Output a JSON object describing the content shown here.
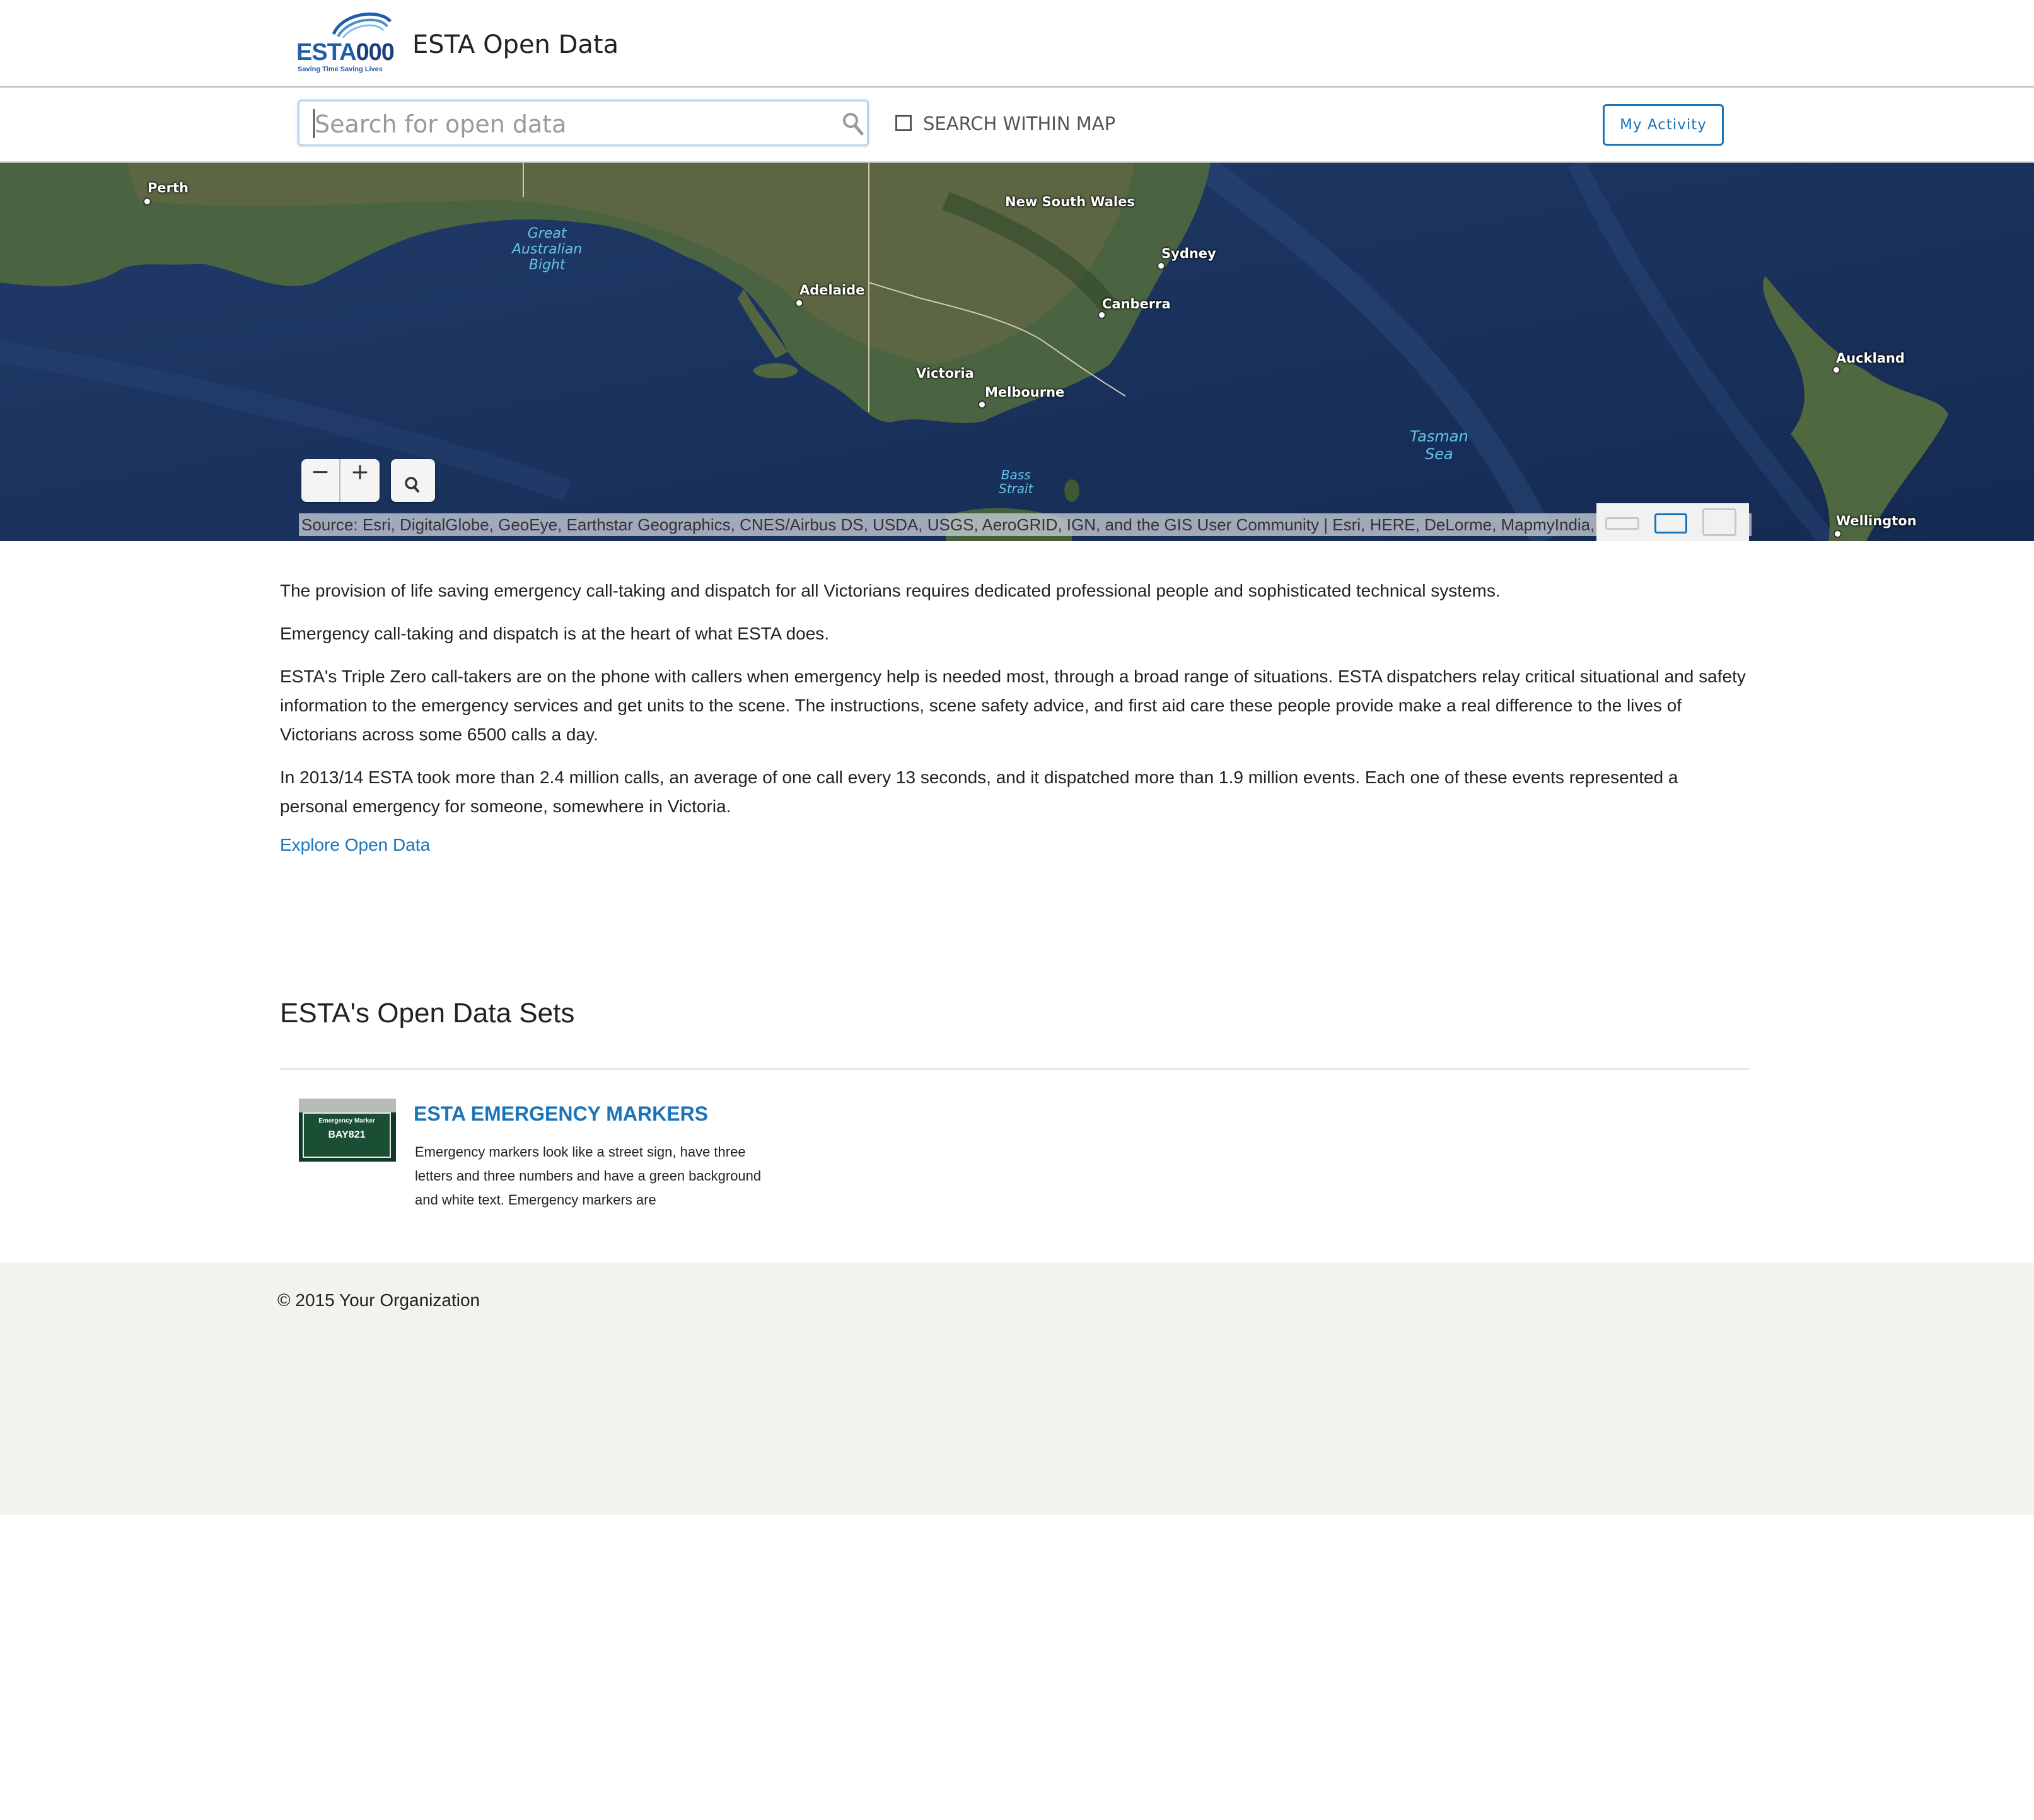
{
  "header": {
    "logo_name": "ESTA",
    "logo_number": "000",
    "logo_tagline": "Saving Time Saving Lives",
    "site_title": "ESTA Open Data"
  },
  "search": {
    "placeholder": "Search for open data",
    "value": "",
    "within_map_label": "SEARCH WITHIN MAP",
    "within_map_checked": false,
    "my_activity_label": "My Activity"
  },
  "map": {
    "city_labels": {
      "perth": "Perth",
      "adelaide": "Adelaide",
      "victoria": "Victoria",
      "melbourne": "Melbourne",
      "canberra": "Canberra",
      "sydney": "Sydney",
      "nsw": "New South Wales",
      "auckland": "Auckland",
      "wellington": "Wellington"
    },
    "water_labels": {
      "bight": "Great\nAustralian\nBight",
      "tasman": "Tasman\nSea",
      "bass": "Bass\nStrait"
    },
    "zoom_out_label": "−",
    "zoom_in_label": "+",
    "attribution": "Source: Esri, DigitalGlobe, GeoEye, Earthstar Geographics, CNES/Airbus DS, USDA, USGS, AeroGRID, IGN, and the GIS User Community | Esri, HERE, DeLorme, MapmyIndia, ©"
  },
  "content": {
    "paragraphs": [
      "The provision of life saving emergency call-taking and dispatch for all Victorians requires dedicated professional people and sophisticated technical systems.",
      "Emergency call-taking and dispatch is at the heart of what ESTA does.",
      "ESTA's Triple Zero call-takers are on the phone with callers when emergency help is needed most, through a broad range of situations. ESTA dispatchers relay critical situational and safety information to the emergency services and get units to the scene. The instructions, scene safety advice, and first aid care these people provide make a real difference to the lives of Victorians across some 6500 calls a day.",
      "In 2013/14 ESTA took more than 2.4 million calls, an average of one call every 13 seconds, and it dispatched more than 1.9 million events. Each one of these events represented a personal emergency for someone, somewhere in Victoria."
    ],
    "explore_link": "Explore Open Data"
  },
  "datasets": {
    "section_title": "ESTA's Open Data Sets",
    "items": [
      {
        "title": "ESTA EMERGENCY MARKERS",
        "thumb_heading": "Emergency Marker",
        "thumb_code": "BAY821",
        "description": "Emergency markers look like a street sign, have three letters and three numbers and have a green background and white text. Emergency markers are"
      }
    ]
  },
  "footer": {
    "copyright": "© 2015 Your Organization"
  },
  "colors": {
    "accent": "#1b73b8",
    "footer_bg": "#f2f2ee",
    "ocean": "#19315c"
  }
}
